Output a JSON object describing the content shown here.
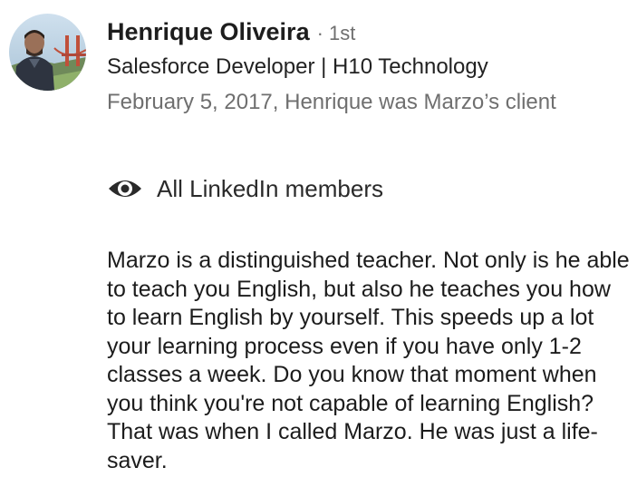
{
  "recommendation": {
    "author": {
      "name": "Henrique Oliveira",
      "degree": "· 1st",
      "headline": "Salesforce Developer | H10 Technology",
      "relationship": "February 5, 2017, Henrique was Marzo’s client"
    },
    "visibility": {
      "icon": "eye-icon",
      "label": "All LinkedIn members"
    },
    "text": "Marzo is a distinguished teacher. Not only is he able to teach you English, but also he teaches you how to learn English by yourself. This speeds up a lot your learning process even if you have only 1-2 classes a week. Do you know that moment when you think you're not capable of learning English? That was when I called Marzo. He was just a life-saver."
  },
  "colors": {
    "name_text": "#1d1d1d",
    "secondary_text": "#6f6f6f",
    "body_text": "#1c1c1c",
    "background": "#ffffff"
  }
}
